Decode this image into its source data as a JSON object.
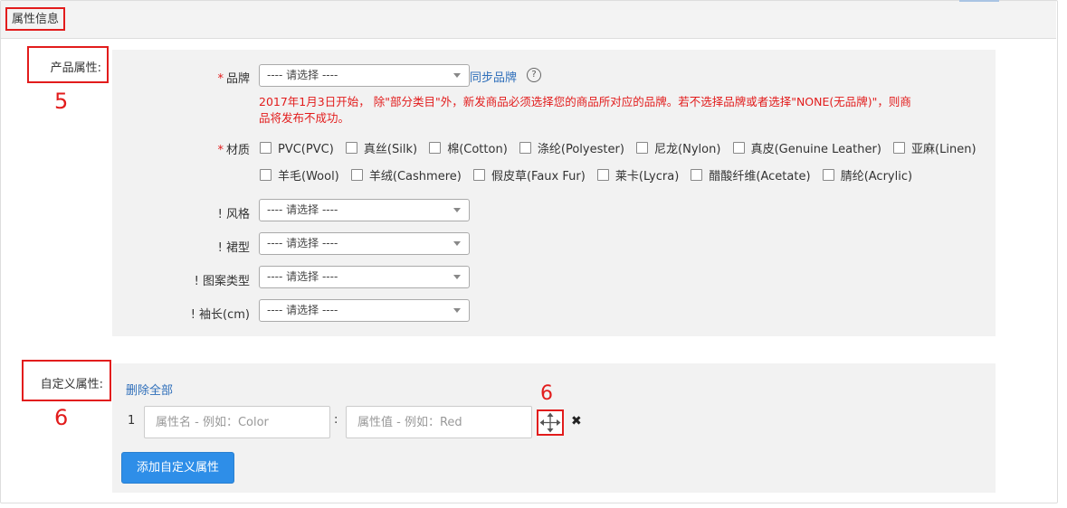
{
  "panel": {
    "title": "属性信息"
  },
  "product_attrs": {
    "label": "产品属性:",
    "step_number": "5",
    "brand": {
      "label": "品牌",
      "select_value": "---- 请选择 ----",
      "sync_link": "同步品牌",
      "help_glyph": "?",
      "warning": "2017年1月3日开始，除\"部分类目\"外，新发商品必须选择您的商品所对应的品牌。若不选择品牌或者选择\"NONE(无品牌)\"，则商品将发布不成功。",
      "warning_line1": "2017年1月3日开始， 除\"部分类目\"外，新发商品必须选择您的商品所对应的品牌。若不选择品牌或者选择\"NONE(无品牌)\"，则商",
      "warning_line2": "品将发布不成功。"
    },
    "material": {
      "label": "材质",
      "options_row1": [
        "PVC(PVC)",
        "真丝(Silk)",
        "棉(Cotton)",
        "涤纶(Polyester)",
        "尼龙(Nylon)",
        "真皮(Genuine Leather)",
        "亚麻(Linen)"
      ],
      "options_row2": [
        "羊毛(Wool)",
        "羊绒(Cashmere)",
        "假皮草(Faux Fur)",
        "莱卡(Lycra)",
        "醋酸纤维(Acetate)",
        "腈纶(Acrylic)"
      ]
    },
    "style": {
      "label": "! 风格",
      "select_value": "---- 请选择 ----"
    },
    "skirt_type": {
      "label": "! 裙型",
      "select_value": "---- 请选择 ----"
    },
    "pattern_type": {
      "label": "! 图案类型",
      "select_value": "---- 请选择 ----"
    },
    "sleeve_length": {
      "label": "! 袖长(cm)",
      "select_value": "---- 请选择 ----"
    },
    "required_mark": "*"
  },
  "custom_attrs": {
    "label": "自定义属性:",
    "step_number": "6",
    "handle_step_number": "6",
    "delete_all": "删除全部",
    "rows": [
      {
        "index": "1",
        "name_placeholder": "属性名 - 例如：Color",
        "separator": ":",
        "value_placeholder": "属性值 - 例如：Red"
      }
    ],
    "add_button": "添加自定义属性",
    "remove_glyph": "✖"
  },
  "colors": {
    "accent": "#2e8ee8",
    "warning": "#e21c1c",
    "link": "#2f6fba",
    "highlight_box": "#e21c1c"
  }
}
